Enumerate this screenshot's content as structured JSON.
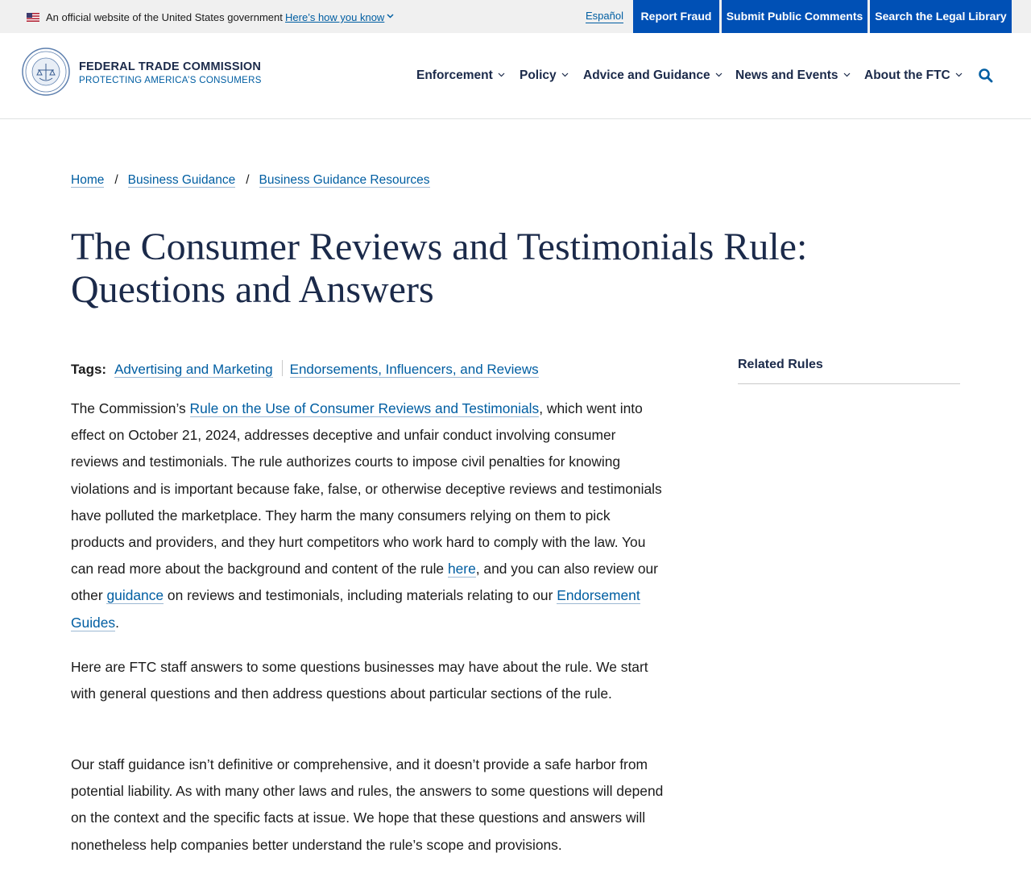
{
  "gov_banner": {
    "text": "An official website of the United States government",
    "how_you_know": "Here’s how you know",
    "espanol": "Español"
  },
  "utility_nav": {
    "report_fraud": "Report Fraud",
    "submit_comments": "Submit Public Comments",
    "legal_library": "Search the Legal Library"
  },
  "header": {
    "agency_name": "FEDERAL TRADE COMMISSION",
    "agency_tagline": "PROTECTING AMERICA’S CONSUMERS",
    "nav": [
      {
        "label": "Enforcement"
      },
      {
        "label": "Policy"
      },
      {
        "label": "Advice and Guidance"
      },
      {
        "label": "News and Events"
      },
      {
        "label": "About the FTC"
      }
    ]
  },
  "breadcrumb": [
    {
      "label": "Home"
    },
    {
      "label": "Business Guidance"
    },
    {
      "label": "Business Guidance Resources"
    }
  ],
  "breadcrumb_separator": "/",
  "page_title": "The Consumer Reviews and Testimonials Rule: Questions and Answers",
  "tags": {
    "label": "Tags:",
    "items": [
      "Advertising and Marketing",
      "Endorsements, Influencers, and Reviews"
    ]
  },
  "content": {
    "p1": {
      "pre_link": "The Commission’s ",
      "rule_link": "Rule on the Use of Consumer Reviews and Testimonials",
      "mid": ", which went into effect on October 21, 2024, addresses deceptive and unfair conduct involving consumer reviews and testimonials. The rule authorizes courts to impose civil penalties for knowing violations and is important because fake, false, or otherwise deceptive reviews and testimonials have polluted the marketplace. They harm the many consumers relying on them to pick products and providers, and they hurt competitors who work hard to comply with the law. You can read more about the background and content of the rule ",
      "here_link": "here",
      "mid2": ", and you can also review our other ",
      "guidance_link": "guidance",
      "mid3": " on reviews and testimonials, including materials relating to our ",
      "guides_link": "Endorsement Guides",
      "end": "."
    },
    "p2": "Here are FTC staff answers to some questions businesses may have about the rule. We start with general questions and then address questions about particular sections of the rule.",
    "p3": "Our staff guidance isn’t definitive or comprehensive, and it doesn’t provide a safe harbor from potential liability. As with many other laws and rules, the answers to some questions will depend on the context and the specific facts at issue. We hope that these questions and answers will nonetheless help companies better understand the rule’s scope and provisions."
  },
  "sidebar": {
    "related_rules": "Related Rules"
  },
  "colors": {
    "primary_blue": "#0050b5",
    "link_blue": "#005ea2",
    "navy_text": "#1b2a4a",
    "banner_gray": "#f0f0f0"
  },
  "icons": [
    "us-flag-icon",
    "chevron-down-icon",
    "ftc-seal-icon",
    "search-icon"
  ]
}
